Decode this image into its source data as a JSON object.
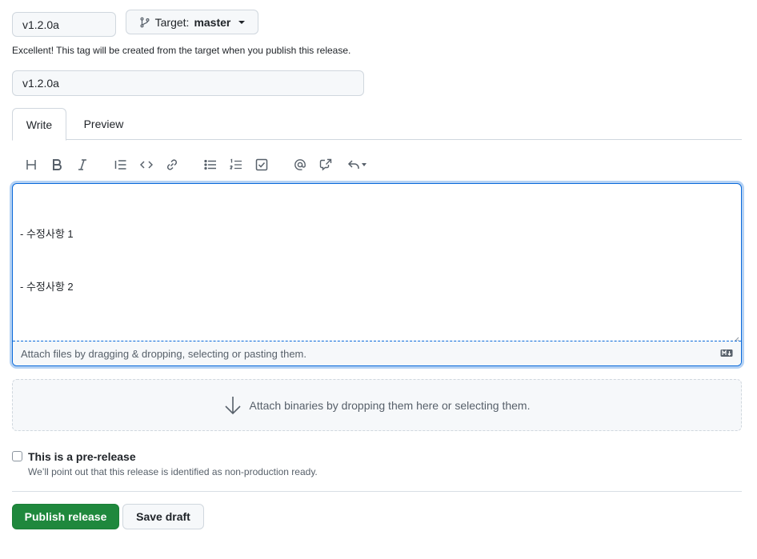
{
  "tag": {
    "value": "v1.2.0a"
  },
  "target": {
    "prefix": "Target:",
    "branch": "master"
  },
  "tag_hint": "Excellent! This tag will be created from the target when you publish this release.",
  "title": {
    "value": "v1.2.0a"
  },
  "tabs": [
    {
      "label": "Write"
    },
    {
      "label": "Preview"
    }
  ],
  "toolbar": {
    "icons": [
      "heading-icon",
      "bold-icon",
      "italic-icon",
      "quote-icon",
      "code-icon",
      "link-icon",
      "bulleted-list-icon",
      "numbered-list-icon",
      "task-list-icon",
      "mention-icon",
      "cross-reference-icon",
      "reply-icon"
    ]
  },
  "editor": {
    "lines": [
      "- 수정사항 1",
      "- 수정사항 2"
    ],
    "attach_hint": "Attach files by dragging & dropping, selecting or pasting them."
  },
  "binaries": {
    "hint": "Attach binaries by dropping them here or selecting them."
  },
  "prerelease": {
    "label": "This is a pre-release",
    "description": "We’ll point out that this release is identified as non-production ready."
  },
  "actions": {
    "publish": "Publish release",
    "save_draft": "Save draft"
  },
  "colors": {
    "accent": "#0969da",
    "primary": "#1f883d",
    "border": "#d0d7de"
  }
}
